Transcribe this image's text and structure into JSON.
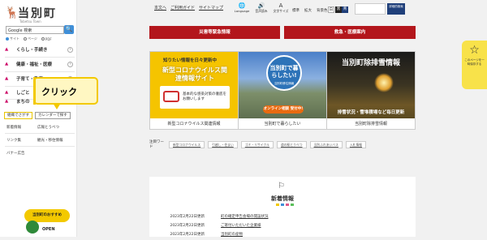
{
  "logo": {
    "name": "当別町",
    "sub": "Tobetsu Town",
    "deer": "🦌"
  },
  "search": {
    "value": "Google 検索",
    "button_icon": "🔍",
    "options": [
      "サイト",
      "ページ",
      "PDF"
    ]
  },
  "sidebar": {
    "items": [
      {
        "label": "くらし・手続き",
        "icon": "▲"
      },
      {
        "label": "健康・福祉・医療",
        "icon": "▲"
      },
      {
        "label": "子育て・教育",
        "icon": "▲"
      },
      {
        "label": "しごと",
        "icon": "▲"
      },
      {
        "label": "まちの",
        "icon": "▲"
      }
    ],
    "buttons": {
      "purpose": "組織でさがす",
      "calendar": "カレンダーで探す"
    },
    "links": [
      {
        "a": "新着情報",
        "b": "広報とうべつ"
      },
      {
        "a": "リンク集",
        "b": "観光・移住情報"
      },
      {
        "a": "バナー広告",
        "b": ""
      }
    ],
    "mascot": {
      "banner": "当別町のおすすめ",
      "open": "OPEN"
    }
  },
  "callout": {
    "text": "クリック"
  },
  "header": {
    "nav": [
      "本文へ",
      "ご利用ガイド",
      "サイトマップ"
    ],
    "tools": [
      {
        "icon": "🌐",
        "label": "Language"
      },
      {
        "icon": "🔊",
        "label": "音声読み"
      },
      {
        "icon": "A",
        "label": "文字サイズ"
      }
    ],
    "font_size": [
      "標準",
      "拡大"
    ],
    "color_label": "背景色",
    "color_options": [
      "白",
      "黒",
      "青"
    ],
    "search_button": "詳細的検索"
  },
  "red_buttons": [
    "災害等緊急情報",
    "救急・医療案内"
  ],
  "cards": [
    {
      "caption": "新型コロナウイルス関連情報",
      "top": "知りたい情報を日々更新中",
      "title": "新型コロナウイルス関連情報サイト",
      "panel": "基本的な感染対策の徹底をお願いします"
    },
    {
      "caption": "当別町で暮らしたい",
      "title": "当別町で暮らしたい!",
      "label": "当別町移住情報",
      "cta": "オンライン相談 受付中!"
    },
    {
      "caption": "当別町除排雪情報",
      "title": "当別町除排雪情報",
      "bottom": "排雪状況・雪堆積場など毎日更新"
    }
  ],
  "tags": {
    "label": "注目ワード",
    "items": [
      "新型コロナウイルス",
      "引越し・住まい",
      "ゴミ・リサイクル",
      "道の駅とうべつ",
      "当別ふれあいバス",
      "入札情報"
    ]
  },
  "news": {
    "title": "新着情報",
    "flag": "⚐",
    "rows": [
      {
        "date": "2023年2月22日更新",
        "title": "町の確定申告会場の開設状況"
      },
      {
        "date": "2023年2月22日更新",
        "title": "ご寄付いただいた企業様"
      },
      {
        "date": "2023年2月22日更新",
        "title": "当別町の産物"
      }
    ],
    "dot_colors": [
      "#f3c900",
      "#3f8fd8",
      "#e05a8a",
      "#5bbf5b"
    ]
  },
  "bookmark": {
    "icon": "☆",
    "text": "このページを一時保存する"
  }
}
